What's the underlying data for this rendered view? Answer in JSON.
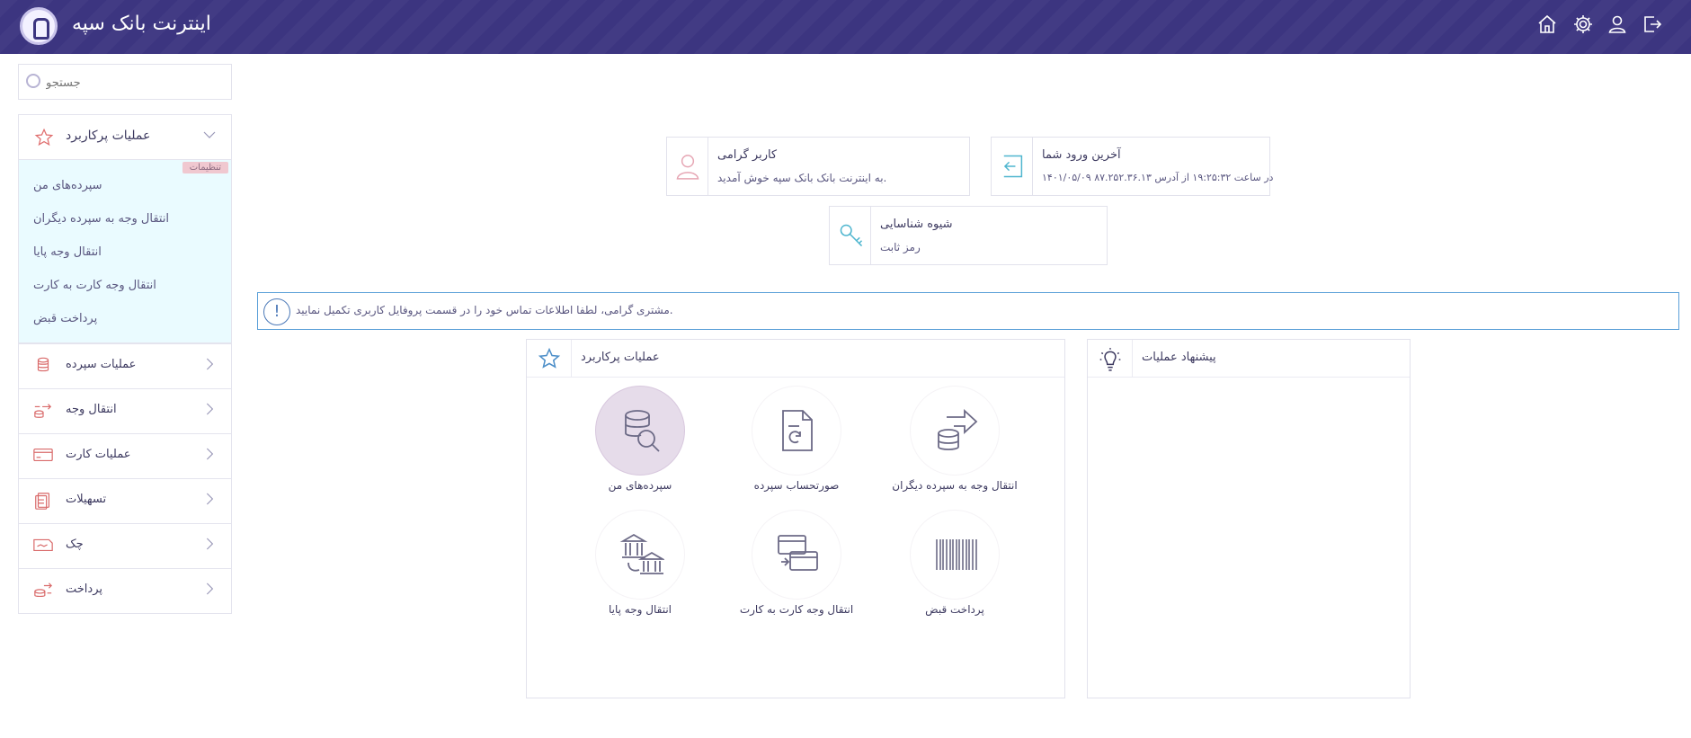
{
  "header": {
    "brand": "اینترنت بانک سپه",
    "icons": [
      "home-icon",
      "gear-icon",
      "user-icon",
      "logout-icon"
    ]
  },
  "search": {
    "placeholder": "جستجو"
  },
  "sidebar": {
    "favorites": {
      "label": "عملیات پرکاربرد",
      "badge": "تنظیمات",
      "items": [
        "سپرده‌های من",
        "انتقال وجه به سپرده دیگران",
        "انتقال وجه پایا",
        "انتقال وجه کارت به کارت",
        "پرداخت قبض"
      ]
    },
    "items": [
      {
        "label": "عملیات سپرده",
        "icon": "coins-icon"
      },
      {
        "label": "انتقال وجه",
        "icon": "transfer-icon"
      },
      {
        "label": "عملیات کارت",
        "icon": "card-icon"
      },
      {
        "label": "تسهیلات",
        "icon": "loan-icon"
      },
      {
        "label": "چک",
        "icon": "cheque-icon"
      },
      {
        "label": "پرداخت",
        "icon": "payment-icon"
      }
    ]
  },
  "info": {
    "user": {
      "title": "کاربر گرامی",
      "text": "به اینترنت بانک بانک سپه خوش آمدید."
    },
    "last_login": {
      "title": "آخرین ورود شما",
      "text": "۱۴۰۱/۰۵/۰۹ در ساعت ۱۹:۲۵:۳۲ از آدرس ۸۷.۲۵۲.۳۶.۱۳"
    },
    "key": {
      "title": "شیوه شناسایی",
      "text": "رمز ثابت"
    }
  },
  "alert": {
    "text": "مشتری گرامی، لطفا اطلاعات تماس خود را در قسمت پروفایل کاربری تکمیل نمایید."
  },
  "panels": {
    "favorites": {
      "title": "عملیات پرکاربرد",
      "tiles": [
        {
          "label": "سپرده‌های من",
          "icon": "deposit-search-icon"
        },
        {
          "label": "صورتحساب سپرده",
          "icon": "statement-icon"
        },
        {
          "label": "انتقال وجه به سپرده دیگران",
          "icon": "deposit-transfer-icon"
        },
        {
          "label": "انتقال وجه پایا",
          "icon": "bank-transfer-icon"
        },
        {
          "label": "انتقال وجه کارت به کارت",
          "icon": "card-transfer-icon"
        },
        {
          "label": "پرداخت قبض",
          "icon": "barcode-icon"
        }
      ]
    },
    "suggestions": {
      "title": "پیشنهاد عملیات"
    }
  }
}
